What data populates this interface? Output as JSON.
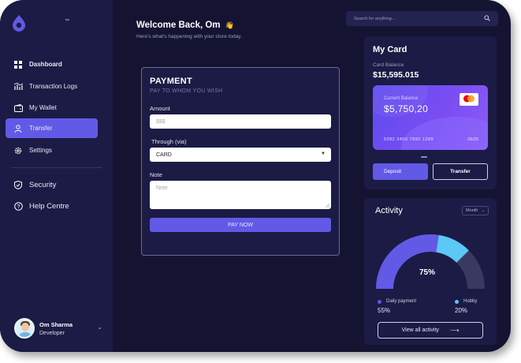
{
  "brand": {
    "tm": "™"
  },
  "sidebar": {
    "items": [
      {
        "label": "Dashboard",
        "icon": "grid-icon"
      },
      {
        "label": "Transaction Logs",
        "icon": "chart-icon"
      },
      {
        "label": "My Wallet",
        "icon": "wallet-icon"
      },
      {
        "label": "Transfer",
        "icon": "user-icon",
        "active": true
      },
      {
        "label": "Settings",
        "icon": "gear-icon"
      },
      {
        "label": "Security",
        "icon": "shield-icon"
      },
      {
        "label": "Help Centre",
        "icon": "help-icon"
      }
    ]
  },
  "profile": {
    "name": "Om Sharma",
    "role": "Developer"
  },
  "header": {
    "welcome": "Welcome Back, Om",
    "wave": "👋",
    "subtitle": "Here's what's happening with your store today.",
    "search_placeholder": "Search for anything..."
  },
  "payment": {
    "title": "PAYMENT",
    "subtitle": "PAY TO WHOM YOU WISH",
    "amount_label": "Amount",
    "amount_placeholder": "$$$",
    "through_label": "Through (via)",
    "through_value": "CARD",
    "note_label": "Note",
    "note_placeholder": "Note",
    "button": "PAY NOW"
  },
  "my_card": {
    "title": "My Card",
    "balance_label": "Card Balance",
    "balance": "$15,595.015",
    "current_label": "Current Balance",
    "current_amount": "$5,750,20",
    "card_number": "5282 3456 7890 1289",
    "expiry": "09/25",
    "deposit": "Deposit",
    "transfer": "Transfer"
  },
  "activity": {
    "title": "Activity",
    "period": "Month",
    "percent": "75%",
    "daily_label": "Daily payment",
    "daily_value": "55%",
    "hobby_label": "Hobby",
    "hobby_value": "20%",
    "view_all": "View all activity",
    "arrow": "⟶",
    "colors": {
      "daily": "#6259e6",
      "hobby": "#5bc8f5",
      "rest": "#3a3a60"
    },
    "daily_fraction": 0.55,
    "hobby_fraction": 0.2
  }
}
